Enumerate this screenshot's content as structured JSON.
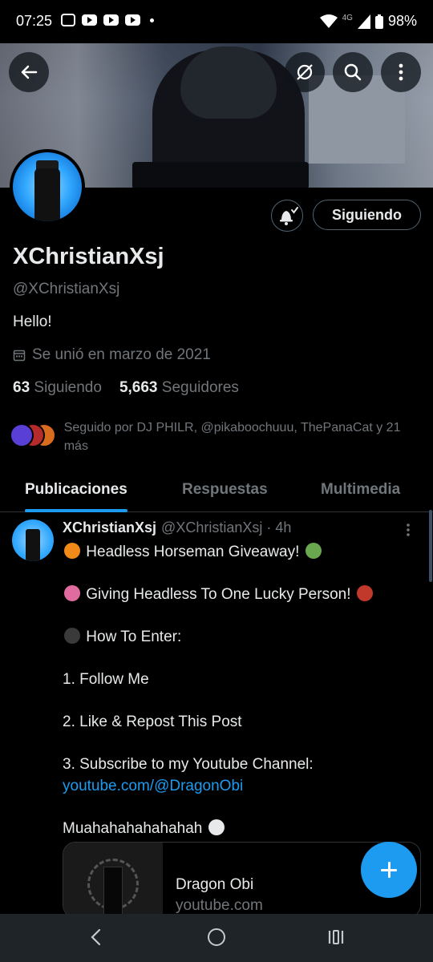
{
  "status_bar": {
    "time": "07:25",
    "network": "4G",
    "battery": "98%"
  },
  "profile": {
    "name": "XChristianXsj",
    "handle": "@XChristianXsj",
    "bio": "Hello!",
    "joined": "Se unió en marzo de 2021",
    "following_count": "63",
    "following_label": "Siguiendo",
    "followers_count": "5,663",
    "followers_label": "Seguidores",
    "followed_by": "Seguido por DJ PHILR, @pikaboochuuu, ThePanaCat y 21 más",
    "follow_button": "Siguiendo"
  },
  "tabs": [
    {
      "label": "Publicaciones",
      "active": true
    },
    {
      "label": "Respuestas",
      "active": false
    },
    {
      "label": "Multimedia",
      "active": false
    }
  ],
  "post": {
    "author": "XChristianXsj",
    "meta": "@XChristianXsj · 4h",
    "line1": "Headless Horseman Giveaway!",
    "line2": "Giving Headless To One Lucky Person!",
    "line3": "How To Enter:",
    "line4": "1. Follow Me",
    "line5": "2. Like & Repost This Post",
    "line6": "3. Subscribe to my Youtube Channel:",
    "link": "youtube.com/@DragonObi",
    "line7": "Muahahahahahahah",
    "card_title": "Dragon Obi",
    "card_url": "youtube.com"
  },
  "colors": {
    "accent": "#1d9bf0",
    "background": "#000000",
    "muted": "#71767b"
  }
}
